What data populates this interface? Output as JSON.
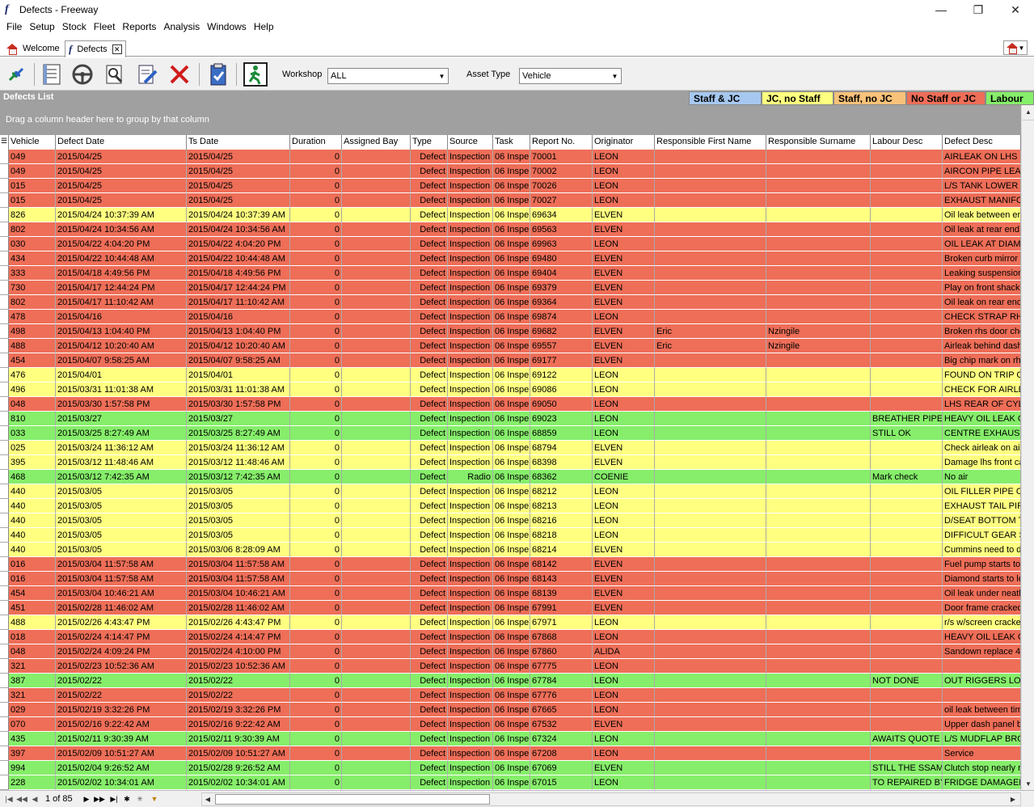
{
  "window": {
    "title": "Defects - Freeway",
    "app_icon": "f-logo",
    "minimize": "—",
    "maximize": "❐",
    "close": "✕"
  },
  "menu": [
    "File",
    "Setup",
    "Stock",
    "Fleet",
    "Reports",
    "Analysis",
    "Windows",
    "Help"
  ],
  "tabs": [
    {
      "label": "Welcome",
      "icon": "home-icon"
    },
    {
      "label": "Defects",
      "icon": "f-logo",
      "active": true
    }
  ],
  "toolbar": {
    "workshop_label": "Workshop",
    "workshop_value": "ALL",
    "asset_type_label": "Asset Type",
    "asset_type_value": "Vehicle"
  },
  "panel": {
    "title": "Defects List",
    "group_hint": "Drag a column header here to group by that column"
  },
  "legend": [
    {
      "label": "Staff & JC",
      "color": "#a6c8f0"
    },
    {
      "label": "JC, no Staff",
      "color": "#ffff80"
    },
    {
      "label": "Staff, no JC",
      "color": "#f8c27a"
    },
    {
      "label": "No Staff or JC",
      "color": "#ee6e58"
    },
    {
      "label": "Labour",
      "color": "#86ee6a"
    }
  ],
  "status_colors": {
    "Y": "#ffff80",
    "R": "#ee6e58",
    "G": "#86ee6a"
  },
  "columns": [
    "Vehicle",
    "Defect Date",
    "Ts Date",
    "Duration",
    "Assigned Bay",
    "Type",
    "Source",
    "Task",
    "Report No.",
    "Originator",
    "Responsible First Name",
    "Responsible Surname",
    "Labour Desc",
    "Defect Desc"
  ],
  "rows": [
    [
      "049",
      "2015/04/25",
      "2015/04/25",
      "0",
      "",
      "Defect",
      "Inspection",
      "06 Inspe",
      "70001",
      "LEON",
      "",
      "",
      "",
      "AIRLEAK ON LHS IN",
      "R"
    ],
    [
      "049",
      "2015/04/25",
      "2015/04/25",
      "0",
      "",
      "Defect",
      "Inspection",
      "06 Inspe",
      "70002",
      "LEON",
      "",
      "",
      "",
      "AIRCON PIPE LEAK",
      "R"
    ],
    [
      "015",
      "2015/04/25",
      "2015/04/25",
      "0",
      "",
      "Defect",
      "Inspection",
      "06 Inspe",
      "70026",
      "LEON",
      "",
      "",
      "",
      "L/S TANK LOWER S",
      "R"
    ],
    [
      "015",
      "2015/04/25",
      "2015/04/25",
      "0",
      "",
      "Defect",
      "Inspection",
      "06 Inspe",
      "70027",
      "LEON",
      "",
      "",
      "",
      "EXHAUST MANIFOL",
      "R"
    ],
    [
      "826",
      "2015/04/24 10:37:39 AM",
      "2015/04/24 10:37:39 AM",
      "0",
      "",
      "Defect",
      "Inspection",
      "06 Inspe",
      "69634",
      "ELVEN",
      "",
      "",
      "",
      "Oil leak between en",
      "Y"
    ],
    [
      "802",
      "2015/04/24 10:34:56 AM",
      "2015/04/24 10:34:56 AM",
      "0",
      "",
      "Defect",
      "Inspection",
      "06 Inspe",
      "69563",
      "ELVEN",
      "",
      "",
      "",
      "Oil leak at rear end",
      "R"
    ],
    [
      "030",
      "2015/04/22 4:04:20 PM",
      "2015/04/22 4:04:20 PM",
      "0",
      "",
      "Defect",
      "Inspection",
      "06 Inspe",
      "69963",
      "LEON",
      "",
      "",
      "",
      "OIL LEAK AT DIAMO",
      "R"
    ],
    [
      "434",
      "2015/04/22 10:44:48 AM",
      "2015/04/22 10:44:48 AM",
      "0",
      "",
      "Defect",
      "Inspection",
      "06 Inspe",
      "69480",
      "ELVEN",
      "",
      "",
      "",
      "Broken curb mirror -",
      "R"
    ],
    [
      "333",
      "2015/04/18 4:49:56 PM",
      "2015/04/18 4:49:56 PM",
      "0",
      "",
      "Defect",
      "Inspection",
      "06 Inspe",
      "69404",
      "ELVEN",
      "",
      "",
      "",
      "Leaking suspension",
      "R"
    ],
    [
      "730",
      "2015/04/17 12:44:24 PM",
      "2015/04/17 12:44:24 PM",
      "0",
      "",
      "Defect",
      "Inspection",
      "06 Inspe",
      "69379",
      "ELVEN",
      "",
      "",
      "",
      "Play on front shackl",
      "R"
    ],
    [
      "802",
      "2015/04/17 11:10:42 AM",
      "2015/04/17 11:10:42 AM",
      "0",
      "",
      "Defect",
      "Inspection",
      "06 Inspe",
      "69364",
      "ELVEN",
      "",
      "",
      "",
      "Oil leak on rear end",
      "R"
    ],
    [
      "478",
      "2015/04/16",
      "2015/04/16",
      "0",
      "",
      "Defect",
      "Inspection",
      "06 Inspe",
      "69874",
      "LEON",
      "",
      "",
      "",
      "CHECK STRAP RHS",
      "R"
    ],
    [
      "498",
      "2015/04/13 1:04:40 PM",
      "2015/04/13 1:04:40 PM",
      "0",
      "",
      "Defect",
      "Inspection",
      "06 Inspe",
      "69682",
      "ELVEN",
      "Eric",
      "Nzingile",
      "",
      "Broken rhs door che",
      "R"
    ],
    [
      "488",
      "2015/04/12 10:20:40 AM",
      "2015/04/12 10:20:40 AM",
      "0",
      "",
      "Defect",
      "Inspection",
      "06 Inspe",
      "69557",
      "ELVEN",
      "Eric",
      "Nzingile",
      "",
      "Airleak behind dash",
      "R"
    ],
    [
      "454",
      "2015/04/07 9:58:25 AM",
      "2015/04/07 9:58:25 AM",
      "0",
      "",
      "Defect",
      "Inspection",
      "06 Inspe",
      "69177",
      "ELVEN",
      "",
      "",
      "",
      "Big chip mark on rhs",
      "R"
    ],
    [
      "476",
      "2015/04/01",
      "2015/04/01",
      "0",
      "",
      "Defect",
      "Inspection",
      "06 Inspe",
      "69122",
      "LEON",
      "",
      "",
      "",
      "FOUND ON TRIP CH",
      "Y"
    ],
    [
      "496",
      "2015/03/31 11:01:38 AM",
      "2015/03/31 11:01:38 AM",
      "0",
      "",
      "Defect",
      "Inspection",
      "06 Inspe",
      "69086",
      "LEON",
      "",
      "",
      "",
      "CHECK FOR AIRLEA",
      "Y"
    ],
    [
      "048",
      "2015/03/30 1:57:58 PM",
      "2015/03/30 1:57:58 PM",
      "0",
      "",
      "Defect",
      "Inspection",
      "06 Inspe",
      "69050",
      "LEON",
      "",
      "",
      "",
      "LHS REAR OF CYLIN",
      "R"
    ],
    [
      "810",
      "2015/03/27",
      "2015/03/27",
      "0",
      "",
      "Defect",
      "Inspection",
      "06 Inspe",
      "69023",
      "LEON",
      "",
      "",
      "BREATHER PIPE N",
      "HEAVY OIL LEAK ON",
      "G"
    ],
    [
      "033",
      "2015/03/25 8:27:49 AM",
      "2015/03/25 8:27:49 AM",
      "0",
      "",
      "Defect",
      "Inspection",
      "06 Inspe",
      "68859",
      "LEON",
      "",
      "",
      "STILL OK",
      "CENTRE EXHAUST M",
      "G"
    ],
    [
      "025",
      "2015/03/24 11:36:12 AM",
      "2015/03/24 11:36:12 AM",
      "0",
      "",
      "Defect",
      "Inspection",
      "06 Inspe",
      "68794",
      "ELVEN",
      "",
      "",
      "",
      "Check airleak on air",
      "Y"
    ],
    [
      "395",
      "2015/03/12 11:48:46 AM",
      "2015/03/12 11:48:46 AM",
      "0",
      "",
      "Defect",
      "Inspection",
      "06 Inspe",
      "68398",
      "ELVEN",
      "",
      "",
      "",
      "Damage lhs front ca",
      "Y"
    ],
    [
      "468",
      "2015/03/12 7:42:35 AM",
      "2015/03/12 7:42:35 AM",
      "0",
      "",
      "Defect",
      "Radio",
      "06 Inspe",
      "68362",
      "COENIE",
      "",
      "",
      "  Mark check",
      "No air",
      "G"
    ],
    [
      "440",
      "2015/03/05",
      "2015/03/05",
      "0",
      "",
      "Defect",
      "Inspection",
      "06 Inspe",
      "68212",
      "LEON",
      "",
      "",
      "",
      "OIL FILLER PIPE ON",
      "Y"
    ],
    [
      "440",
      "2015/03/05",
      "2015/03/05",
      "0",
      "",
      "Defect",
      "Inspection",
      "06 Inspe",
      "68213",
      "LEON",
      "",
      "",
      "",
      "EXHAUST TAIL PIPE",
      "Y"
    ],
    [
      "440",
      "2015/03/05",
      "2015/03/05",
      "0",
      "",
      "Defect",
      "Inspection",
      "06 Inspe",
      "68216",
      "LEON",
      "",
      "",
      "",
      "D/SEAT BOTTOM TO",
      "Y"
    ],
    [
      "440",
      "2015/03/05",
      "2015/03/05",
      "0",
      "",
      "Defect",
      "Inspection",
      "06 Inspe",
      "68218",
      "LEON",
      "",
      "",
      "",
      "DIFFICULT GEAR SE",
      "Y"
    ],
    [
      "440",
      "2015/03/05",
      "2015/03/06 8:28:09 AM",
      "0",
      "",
      "Defect",
      "Inspection",
      "06 Inspe",
      "68214",
      "ELVEN",
      "",
      "",
      "",
      "Cummins need to do",
      "Y"
    ],
    [
      "016",
      "2015/03/04 11:57:58 AM",
      "2015/03/04 11:57:58 AM",
      "0",
      "",
      "Defect",
      "Inspection",
      "06 Inspe",
      "68142",
      "ELVEN",
      "",
      "",
      "",
      "Fuel pump starts to",
      "R"
    ],
    [
      "016",
      "2015/03/04 11:57:58 AM",
      "2015/03/04 11:57:58 AM",
      "0",
      "",
      "Defect",
      "Inspection",
      "06 Inspe",
      "68143",
      "ELVEN",
      "",
      "",
      "",
      "Diamond starts to le",
      "R"
    ],
    [
      "454",
      "2015/03/04 10:46:21 AM",
      "2015/03/04 10:46:21 AM",
      "0",
      "",
      "Defect",
      "Inspection",
      "06 Inspe",
      "68139",
      "ELVEN",
      "",
      "",
      "",
      "Oil leak under neath",
      "R"
    ],
    [
      "451",
      "2015/02/28 11:46:02 AM",
      "2015/02/28 11:46:02 AM",
      "0",
      "",
      "Defect",
      "Inspection",
      "06 Inspe",
      "67991",
      "ELVEN",
      "",
      "",
      "",
      "Door frame cracked",
      "R"
    ],
    [
      "488",
      "2015/02/26 4:43:47 PM",
      "2015/02/26 4:43:47 PM",
      "0",
      "",
      "Defect",
      "Inspection",
      "06 Inspe",
      "67971",
      "LEON",
      "",
      "",
      "",
      "r/s w/screen cracke",
      "Y"
    ],
    [
      "018",
      "2015/02/24 4:14:47 PM",
      "2015/02/24 4:14:47 PM",
      "0",
      "",
      "Defect",
      "Inspection",
      "06 Inspe",
      "67868",
      "LEON",
      "",
      "",
      "",
      "HEAVY OIL LEAK ON",
      "R"
    ],
    [
      "048",
      "2015/02/24 4:09:24 PM",
      "2015/02/24 4:10:00 PM",
      "0",
      "",
      "Defect",
      "Inspection",
      "06 Inspe",
      "67860",
      "ALIDA",
      "",
      "",
      "",
      "Sandown replace 4",
      "R"
    ],
    [
      "321",
      "2015/02/23 10:52:36 AM",
      "2015/02/23 10:52:36 AM",
      "0",
      "",
      "Defect",
      "Inspection",
      "06 Inspe",
      "67775",
      "LEON",
      "",
      "",
      "",
      "",
      "R"
    ],
    [
      "387",
      "2015/02/22",
      "2015/02/22",
      "0",
      "",
      "Defect",
      "Inspection",
      "06 Inspe",
      "67784",
      "LEON",
      "",
      "",
      "NOT DONE",
      "OUT RIGGERS LOOS",
      "G"
    ],
    [
      "321",
      "2015/02/22",
      "2015/02/22",
      "0",
      "",
      "Defect",
      "Inspection",
      "06 Inspe",
      "67776",
      "LEON",
      "",
      "",
      "",
      "",
      "R"
    ],
    [
      "029",
      "2015/02/19 3:32:26 PM",
      "2015/02/19 3:32:26 PM",
      "0",
      "",
      "Defect",
      "Inspection",
      "06 Inspe",
      "67665",
      "LEON",
      "",
      "",
      "",
      "oil leak between tim",
      "R"
    ],
    [
      "070",
      "2015/02/16 9:22:42 AM",
      "2015/02/16 9:22:42 AM",
      "0",
      "",
      "Defect",
      "Inspection",
      "06 Inspe",
      "67532",
      "ELVEN",
      "",
      "",
      "",
      "Upper dash panel b",
      "R"
    ],
    [
      "435",
      "2015/02/11 9:30:39 AM",
      "2015/02/11 9:30:39 AM",
      "0",
      "",
      "Defect",
      "Inspection",
      "06 Inspe",
      "67324",
      "LEON",
      "",
      "",
      "AWAITS QUOTE",
      "L/S MUDFLAP BROK",
      "G"
    ],
    [
      "397",
      "2015/02/09 10:51:27 AM",
      "2015/02/09 10:51:27 AM",
      "0",
      "",
      "Defect",
      "Inspection",
      "06 Inspe",
      "67208",
      "LEON",
      "",
      "",
      "",
      "Service",
      "R"
    ],
    [
      "994",
      "2015/02/04 9:26:52 AM",
      "2015/02/28 9:26:52 AM",
      "0",
      "",
      "Defect",
      "Inspection",
      "06 Inspe",
      "67069",
      "ELVEN",
      "",
      "",
      "STILL THE SSAME",
      "Clutch stop nearly r",
      "G"
    ],
    [
      "228",
      "2015/02/02 10:34:01 AM",
      "2015/02/02 10:34:01 AM",
      "0",
      "",
      "Defect",
      "Inspection",
      "06 Inspe",
      "67015",
      "LEON",
      "",
      "",
      "TO REPAIRED BY",
      "FRIDGE DAMAGED",
      "G"
    ]
  ],
  "footer": {
    "page_info": "1 of 85"
  }
}
